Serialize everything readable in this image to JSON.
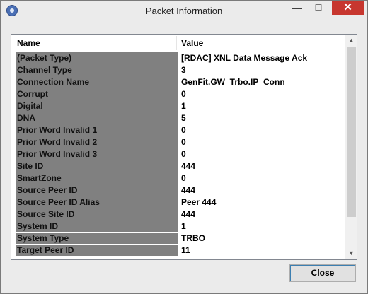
{
  "window": {
    "title": "Packet Information",
    "close_glyph": "✕",
    "minimize_glyph": "—",
    "maximize_glyph": "☐"
  },
  "columns": {
    "name": "Name",
    "value": "Value"
  },
  "rows": [
    {
      "name": "(Packet Type)",
      "value": "[RDAC] XNL Data Message Ack"
    },
    {
      "name": "Channel Type",
      "value": "3"
    },
    {
      "name": "Connection Name",
      "value": "GenFit.GW_Trbo.IP_Conn"
    },
    {
      "name": "Corrupt",
      "value": "0"
    },
    {
      "name": "Digital",
      "value": "1"
    },
    {
      "name": "DNA",
      "value": "5"
    },
    {
      "name": "Prior Word Invalid 1",
      "value": "0"
    },
    {
      "name": "Prior Word Invalid 2",
      "value": "0"
    },
    {
      "name": "Prior Word Invalid 3",
      "value": "0"
    },
    {
      "name": "Site ID",
      "value": "444"
    },
    {
      "name": "SmartZone",
      "value": "0"
    },
    {
      "name": "Source Peer ID",
      "value": "444"
    },
    {
      "name": "Source Peer ID Alias",
      "value": "Peer 444"
    },
    {
      "name": "Source Site ID",
      "value": "444"
    },
    {
      "name": "System ID",
      "value": "1"
    },
    {
      "name": "System Type",
      "value": "TRBO"
    },
    {
      "name": "Target Peer ID",
      "value": "11"
    }
  ],
  "scrollbar": {
    "up_glyph": "▲",
    "down_glyph": "▼"
  },
  "buttons": {
    "close_label": "Close"
  }
}
